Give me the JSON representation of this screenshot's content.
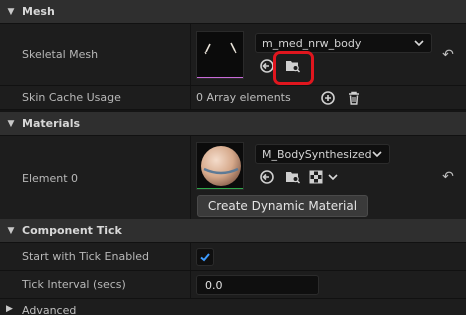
{
  "sections": {
    "mesh": "Mesh",
    "materials": "Materials",
    "component_tick": "Component Tick",
    "advanced": "Advanced"
  },
  "mesh": {
    "skeletal_mesh_label": "Skeletal Mesh",
    "skeletal_mesh_value": "m_med_nrw_body",
    "skin_cache_label": "Skin Cache Usage",
    "skin_cache_value": "0 Array elements"
  },
  "materials": {
    "element_label": "Element 0",
    "element_value": "M_BodySynthesized",
    "create_button": "Create Dynamic Material"
  },
  "tick": {
    "start_enabled_label": "Start with Tick Enabled",
    "start_enabled_checked": true,
    "interval_label": "Tick Interval (secs)",
    "interval_value": "0.0"
  },
  "icons": {
    "section_expanded": "triangle-down-icon",
    "section_collapsed": "triangle-right-icon",
    "use_selected": "arrow-left-circle-icon",
    "browse": "folder-search-icon",
    "add": "plus-circle-icon",
    "delete": "trash-icon",
    "reset": "reset-arrow-icon",
    "checker": "checkerboard-icon"
  },
  "colors": {
    "highlight": "#e0161e",
    "checkbox_check": "#3d9bff",
    "mesh_underline": "#c86ad8",
    "material_underline": "#2fa84a"
  }
}
